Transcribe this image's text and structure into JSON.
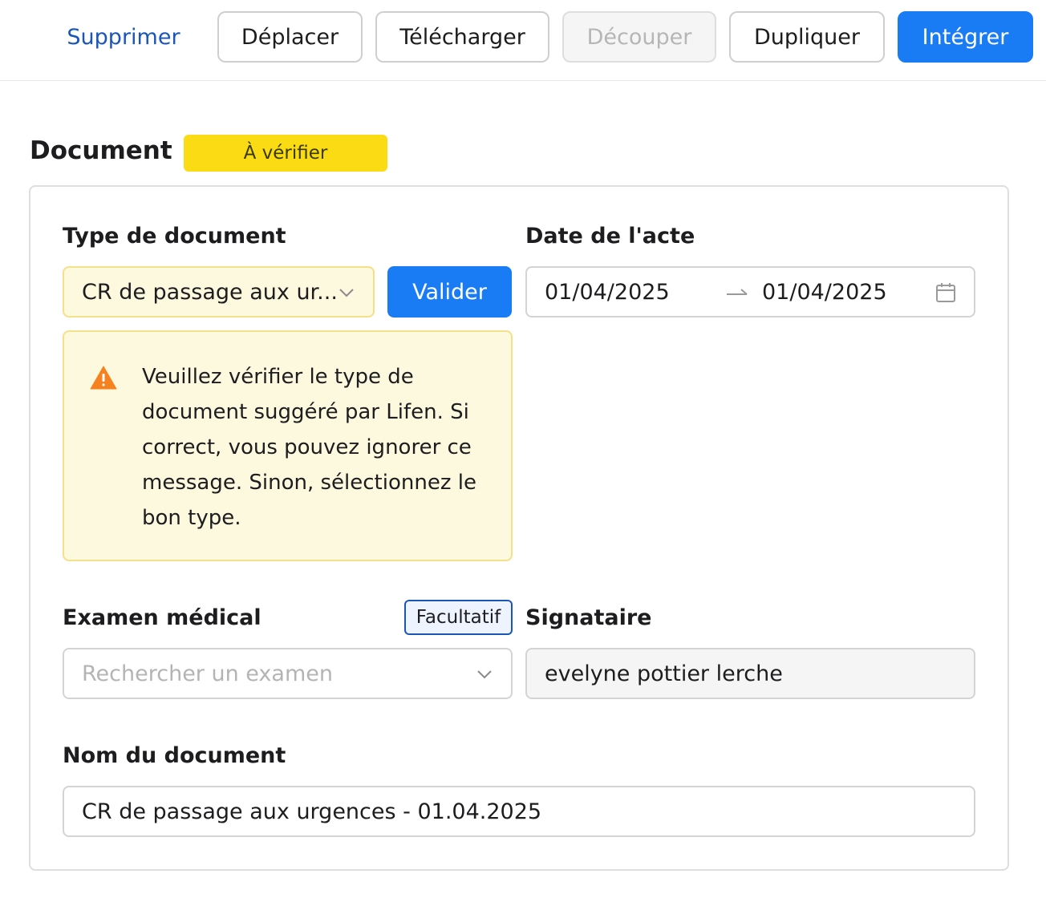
{
  "toolbar": {
    "delete_label": "Supprimer",
    "move_label": "Déplacer",
    "download_label": "Télécharger",
    "split_label": "Découper",
    "duplicate_label": "Dupliquer",
    "integrate_label": "Intégrer"
  },
  "document": {
    "title": "Document",
    "status": "À vérifier"
  },
  "form": {
    "doc_type": {
      "label": "Type de document",
      "value": "CR de passage aux ur...",
      "validate_label": "Valider"
    },
    "warning": {
      "icon": "warning-triangle-icon",
      "message": "Veuillez vérifier le type de document suggéré par Lifen. Si correct, vous pouvez ignorer ce message. Sinon, sélectionnez le bon type."
    },
    "date": {
      "label": "Date de l'acte",
      "start": "01/04/2025",
      "end": "01/04/2025"
    },
    "exam": {
      "label": "Examen médical",
      "optional_badge": "Facultatif",
      "placeholder": "Rechercher un examen"
    },
    "signer": {
      "label": "Signataire",
      "value": "evelyne pottier lerche"
    },
    "doc_name": {
      "label": "Nom du document",
      "value": "CR de passage aux urgences - 01.04.2025"
    }
  },
  "colors": {
    "primary": "#1a7cf5",
    "link": "#1a56b8",
    "status_badge": "#fbdb14",
    "warning_bg": "#fdf9df",
    "warning_icon": "#f5821f"
  }
}
